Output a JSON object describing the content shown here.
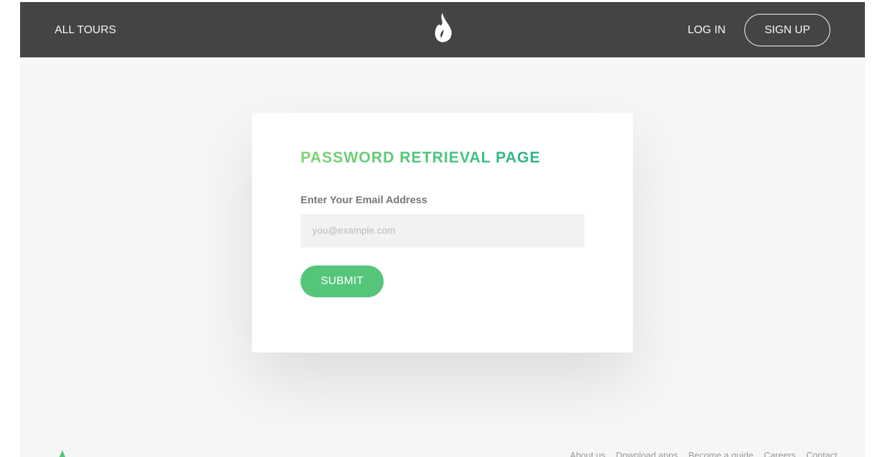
{
  "nav": {
    "all_tours": "ALL TOURS",
    "login": "LOG IN",
    "signup": "SIGN UP",
    "logo_icon": "flame-icon"
  },
  "card": {
    "title": "PASSWORD RETRIEVAL PAGE",
    "email_label": "Enter Your Email Address",
    "email_placeholder": "you@example.com",
    "email_value": "",
    "submit_label": "SUBMIT"
  },
  "footer": {
    "logo_icon": "logo-icon",
    "links": [
      "About us",
      "Download apps",
      "Become a guide",
      "Careers",
      "Contact"
    ]
  },
  "colors": {
    "navbar_bg": "#444444",
    "page_bg": "#f6f6f6",
    "accent_green": "#55c57a",
    "title_gradient_start": "#7dd56f",
    "title_gradient_end": "#28b487"
  }
}
